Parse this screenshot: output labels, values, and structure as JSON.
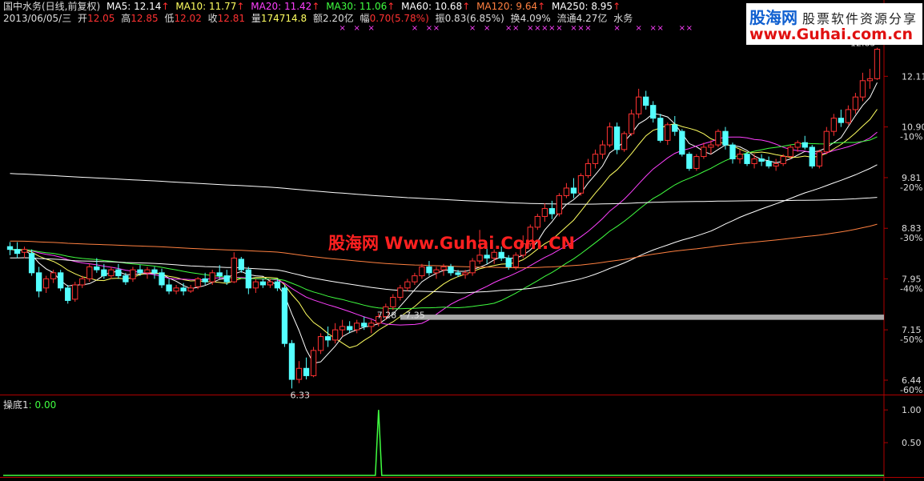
{
  "header": {
    "stock_name": "国中水务(日线,前复权)",
    "ma": [
      {
        "label": "MA5: 12.14",
        "color": "#ffffff"
      },
      {
        "label": "MA10: 11.77",
        "color": "#ffff60"
      },
      {
        "label": "MA20: 11.42",
        "color": "#ff40ff"
      },
      {
        "label": "MA30: 11.06",
        "color": "#40ff40"
      },
      {
        "label": "MA60: 10.68",
        "color": "#ffffff"
      },
      {
        "label": "MA120: 9.64",
        "color": "#ff8040"
      },
      {
        "label": "MA250: 8.95",
        "color": "#ffffff"
      }
    ],
    "arrow": "↑",
    "date": "2013/06/05/三",
    "open_label": "开",
    "open": "12.05",
    "high_label": "高",
    "high": "12.85",
    "low_label": "低",
    "low": "12.02",
    "close_label": "收",
    "close": "12.81",
    "vol_label": "量",
    "vol": "174714.8",
    "amount_label": "额",
    "amount": "2.20亿",
    "change_label": "幅",
    "change": "0.70(5.78%)",
    "amp_label": "振",
    "amp": "0.83(6.85%)",
    "turnover_label": "换",
    "turnover": "4.09%",
    "float_label": "流通",
    "float": "4.27亿",
    "sector": "水务"
  },
  "logo": {
    "brand": "股海网",
    "slogan": "股票软件资源分享",
    "url": "www.Guhai.com.cn"
  },
  "watermark": "股海网 Www.Guhai.Com.CN",
  "indicator": {
    "name": "操底1",
    "value": ": 0.00"
  },
  "colors": {
    "up": "#ff3232",
    "down": "#54ffff",
    "axis": "#b00000",
    "marker": "#ff40ff",
    "indicator": "#40ff40"
  },
  "chart_data": {
    "type": "candlestick",
    "price_axis": {
      "ticks": [
        "12.11",
        "10.90",
        "9.81",
        "8.83",
        "7.95",
        "7.15",
        "6.44"
      ],
      "tick_values": [
        12.11,
        10.9,
        9.81,
        8.83,
        7.95,
        7.15,
        6.44
      ],
      "pct_labels": [
        "-10%",
        "-20%",
        "-30%",
        "-40%",
        "-50%",
        "-60%"
      ],
      "pct_values": [
        10.9,
        9.81,
        8.83,
        7.95,
        7.15,
        6.44
      ],
      "scale": "log",
      "range": [
        6.25,
        13.5
      ]
    },
    "annotations": [
      {
        "text": "12.85",
        "price": 12.85,
        "index": 120
      },
      {
        "text": "6.33",
        "price": 6.33,
        "index": 39
      },
      {
        "text": "7.28 - 7.35",
        "price": 7.3,
        "index": 51
      }
    ],
    "support_band": {
      "price_low": 7.3,
      "price_high": 7.38,
      "from_index": 54
    },
    "marker_glyph": "×",
    "marker_indices": [
      46,
      48,
      50,
      56,
      58,
      59,
      64,
      66,
      69,
      70,
      72,
      73,
      74,
      75,
      76,
      78,
      79,
      80,
      84,
      87,
      89,
      90,
      93,
      94,
      110,
      111,
      112
    ],
    "ma250_start": 9.9,
    "ohlc": [
      [
        8.5,
        8.58,
        8.35,
        8.45
      ],
      [
        8.45,
        8.58,
        8.3,
        8.38
      ],
      [
        8.4,
        8.5,
        8.3,
        8.45
      ],
      [
        8.38,
        8.45,
        8.0,
        8.05
      ],
      [
        8.05,
        8.15,
        7.65,
        7.75
      ],
      [
        7.8,
        8.0,
        7.72,
        7.95
      ],
      [
        7.95,
        8.1,
        7.88,
        8.05
      ],
      [
        8.05,
        8.1,
        7.75,
        7.8
      ],
      [
        7.8,
        7.85,
        7.55,
        7.6
      ],
      [
        7.62,
        7.9,
        7.58,
        7.85
      ],
      [
        7.85,
        8.0,
        7.8,
        7.95
      ],
      [
        7.95,
        8.2,
        7.9,
        8.15
      ],
      [
        8.15,
        8.3,
        8.05,
        8.1
      ],
      [
        8.1,
        8.2,
        7.95,
        8.0
      ],
      [
        8.0,
        8.15,
        7.95,
        8.1
      ],
      [
        8.1,
        8.2,
        7.95,
        8.0
      ],
      [
        8.0,
        8.05,
        7.85,
        7.9
      ],
      [
        7.95,
        8.15,
        7.9,
        8.1
      ],
      [
        8.1,
        8.18,
        8.0,
        8.05
      ],
      [
        8.05,
        8.15,
        7.95,
        8.1
      ],
      [
        8.1,
        8.15,
        7.95,
        8.05
      ],
      [
        8.05,
        8.12,
        7.8,
        7.85
      ],
      [
        7.85,
        7.95,
        7.7,
        7.75
      ],
      [
        7.75,
        7.85,
        7.7,
        7.8
      ],
      [
        7.8,
        7.88,
        7.68,
        7.75
      ],
      [
        7.75,
        7.85,
        7.72,
        7.8
      ],
      [
        7.82,
        7.98,
        7.78,
        7.95
      ],
      [
        7.95,
        8.05,
        7.85,
        7.9
      ],
      [
        7.9,
        8.1,
        7.85,
        8.05
      ],
      [
        8.05,
        8.18,
        7.95,
        8.0
      ],
      [
        8.0,
        8.1,
        7.85,
        7.9
      ],
      [
        7.9,
        8.4,
        7.88,
        8.3
      ],
      [
        8.28,
        8.32,
        8.05,
        8.1
      ],
      [
        8.1,
        8.15,
        7.7,
        7.8
      ],
      [
        7.8,
        7.95,
        7.72,
        7.9
      ],
      [
        7.9,
        7.95,
        7.8,
        7.85
      ],
      [
        7.85,
        7.95,
        7.8,
        7.9
      ],
      [
        7.9,
        7.95,
        7.75,
        7.8
      ],
      [
        7.8,
        7.85,
        6.9,
        6.95
      ],
      [
        6.95,
        7.0,
        6.33,
        6.45
      ],
      [
        6.45,
        6.7,
        6.4,
        6.6
      ],
      [
        6.6,
        6.75,
        6.45,
        6.5
      ],
      [
        6.5,
        6.9,
        6.48,
        6.85
      ],
      [
        6.85,
        7.1,
        6.8,
        7.05
      ],
      [
        7.05,
        7.2,
        6.9,
        7.0
      ],
      [
        7.0,
        7.25,
        6.95,
        7.15
      ],
      [
        7.15,
        7.3,
        7.05,
        7.2
      ],
      [
        7.2,
        7.28,
        7.1,
        7.15
      ],
      [
        7.15,
        7.3,
        7.1,
        7.25
      ],
      [
        7.25,
        7.35,
        7.15,
        7.2
      ],
      [
        7.2,
        7.3,
        7.1,
        7.25
      ],
      [
        7.25,
        7.4,
        7.2,
        7.35
      ],
      [
        7.35,
        7.55,
        7.3,
        7.5
      ],
      [
        7.5,
        7.7,
        7.45,
        7.65
      ],
      [
        7.65,
        7.85,
        7.6,
        7.8
      ],
      [
        7.8,
        7.95,
        7.75,
        7.9
      ],
      [
        7.9,
        8.05,
        7.85,
        8.0
      ],
      [
        8.0,
        8.2,
        7.95,
        8.15
      ],
      [
        8.15,
        8.25,
        8.0,
        8.05
      ],
      [
        8.05,
        8.15,
        7.95,
        8.1
      ],
      [
        8.1,
        8.2,
        8.0,
        8.15
      ],
      [
        8.15,
        8.2,
        8.0,
        8.05
      ],
      [
        8.05,
        8.1,
        7.98,
        8.02
      ],
      [
        8.02,
        8.1,
        7.95,
        8.05
      ],
      [
        8.05,
        8.3,
        8.0,
        8.25
      ],
      [
        8.25,
        8.8,
        8.2,
        8.35
      ],
      [
        8.35,
        8.5,
        8.2,
        8.3
      ],
      [
        8.3,
        8.45,
        8.2,
        8.4
      ],
      [
        8.4,
        8.5,
        8.25,
        8.3
      ],
      [
        8.3,
        8.35,
        8.1,
        8.15
      ],
      [
        8.15,
        8.4,
        8.1,
        8.35
      ],
      [
        8.35,
        8.7,
        8.3,
        8.55
      ],
      [
        8.55,
        8.9,
        8.5,
        8.85
      ],
      [
        8.85,
        9.1,
        8.8,
        9.05
      ],
      [
        9.05,
        9.3,
        8.95,
        9.2
      ],
      [
        9.2,
        9.35,
        9.0,
        9.1
      ],
      [
        9.1,
        9.5,
        9.05,
        9.45
      ],
      [
        9.45,
        9.7,
        9.4,
        9.6
      ],
      [
        9.6,
        9.8,
        9.4,
        9.5
      ],
      [
        9.5,
        9.9,
        9.45,
        9.85
      ],
      [
        9.85,
        10.2,
        9.8,
        10.1
      ],
      [
        10.1,
        10.4,
        10.0,
        10.3
      ],
      [
        10.3,
        10.6,
        10.2,
        10.5
      ],
      [
        10.5,
        11.0,
        10.45,
        10.9
      ],
      [
        10.9,
        11.0,
        10.3,
        10.4
      ],
      [
        10.4,
        10.8,
        10.35,
        10.75
      ],
      [
        10.75,
        11.3,
        10.7,
        11.2
      ],
      [
        11.2,
        11.8,
        11.1,
        11.6
      ],
      [
        11.6,
        11.75,
        11.3,
        11.4
      ],
      [
        11.4,
        11.5,
        11.0,
        11.1
      ],
      [
        11.1,
        11.2,
        10.55,
        10.6
      ],
      [
        10.6,
        11.0,
        10.5,
        10.95
      ],
      [
        10.95,
        11.15,
        10.7,
        10.8
      ],
      [
        10.8,
        10.85,
        10.25,
        10.3
      ],
      [
        10.3,
        10.35,
        9.95,
        10.0
      ],
      [
        10.0,
        10.3,
        9.95,
        10.25
      ],
      [
        10.25,
        10.55,
        10.2,
        10.45
      ],
      [
        10.45,
        10.6,
        10.3,
        10.5
      ],
      [
        10.5,
        10.85,
        10.45,
        10.8
      ],
      [
        10.8,
        10.9,
        10.4,
        10.5
      ],
      [
        10.5,
        10.55,
        10.1,
        10.2
      ],
      [
        10.2,
        10.4,
        10.1,
        10.3
      ],
      [
        10.3,
        10.35,
        10.05,
        10.1
      ],
      [
        10.1,
        10.3,
        10.0,
        10.2
      ],
      [
        10.2,
        10.3,
        10.05,
        10.15
      ],
      [
        10.15,
        10.25,
        10.0,
        10.05
      ],
      [
        10.05,
        10.2,
        9.95,
        10.1
      ],
      [
        10.1,
        10.3,
        10.05,
        10.25
      ],
      [
        10.25,
        10.5,
        10.2,
        10.45
      ],
      [
        10.45,
        10.6,
        10.35,
        10.55
      ],
      [
        10.55,
        10.7,
        10.4,
        10.45
      ],
      [
        10.45,
        10.5,
        10.0,
        10.05
      ],
      [
        10.05,
        10.4,
        10.0,
        10.35
      ],
      [
        10.35,
        10.9,
        10.3,
        10.8
      ],
      [
        10.8,
        11.2,
        10.7,
        11.1
      ],
      [
        11.1,
        11.3,
        10.9,
        11.0
      ],
      [
        11.0,
        11.4,
        10.95,
        11.3
      ],
      [
        11.3,
        11.7,
        11.2,
        11.6
      ],
      [
        11.6,
        12.2,
        11.5,
        12.0
      ],
      [
        12.0,
        12.3,
        11.8,
        12.05
      ],
      [
        12.05,
        12.85,
        12.02,
        12.81
      ]
    ],
    "indicator_axis": {
      "ticks": [
        "1.00",
        "0.50"
      ],
      "tick_values": [
        1.0,
        0.5
      ],
      "range": [
        0,
        1.1
      ]
    },
    "indicator_values": {
      "baseline": 0.0,
      "spike_index": 51,
      "spike_value": 1.0
    }
  }
}
